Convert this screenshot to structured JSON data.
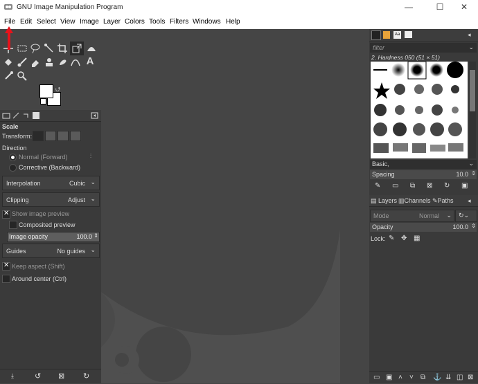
{
  "window": {
    "title": "GNU Image Manipulation Program",
    "minimize": "—",
    "maximize": "☐",
    "close": "✕"
  },
  "menu": [
    "File",
    "Edit",
    "Select",
    "View",
    "Image",
    "Layer",
    "Colors",
    "Tools",
    "Filters",
    "Windows",
    "Help"
  ],
  "tool_options": {
    "title": "Scale",
    "transform_label": "Transform:",
    "direction_label": "Direction",
    "direction_options": [
      "Normal (Forward)",
      "Corrective (Backward)"
    ],
    "direction_selected": 0,
    "interpolation": {
      "label": "Interpolation",
      "value": "Cubic"
    },
    "clipping": {
      "label": "Clipping",
      "value": "Adjust"
    },
    "show_preview": {
      "label": "Show image preview",
      "checked": true
    },
    "composited_preview": {
      "label": "Composited preview",
      "checked": false
    },
    "image_opacity": {
      "label": "Image opacity",
      "value": "100.0"
    },
    "guides": {
      "label": "Guides",
      "value": "No guides"
    },
    "keep_aspect": {
      "label": "Keep aspect (Shift)",
      "checked": true
    },
    "around_center": {
      "label": "Around center (Ctrl)",
      "checked": false
    }
  },
  "brushes": {
    "filter_placeholder": "filter",
    "current_brush": "2. Hardness 050 (51 × 51)",
    "preset": "Basic,",
    "spacing_label": "Spacing",
    "spacing_value": "10.0"
  },
  "layers": {
    "tabs": [
      "Layers",
      "Channels",
      "Paths"
    ],
    "mode_label": "Mode",
    "mode_value": "Normal",
    "opacity_label": "Opacity",
    "opacity_value": "100.0",
    "lock_label": "Lock:"
  },
  "colors": {
    "accent_red": "#e8121b",
    "bg_dark": "#454545",
    "panel": "#3a3a3a"
  }
}
